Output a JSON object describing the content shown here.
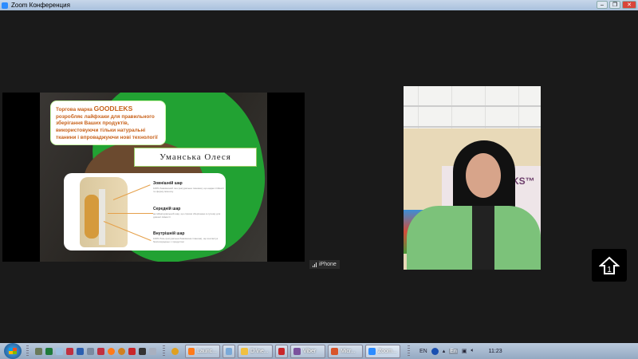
{
  "window": {
    "title": "Zoom Конференция"
  },
  "slide": {
    "callout": {
      "prefix": "Торгова марка ",
      "brand": "GOODLEKS",
      "text": " розробляє лайфхаки для правильного зберігання Ваших продуктів, використовуючи тільки натуральні тканини і впроваджуючи нові технології"
    },
    "name_label": "Уманська Олеся",
    "layers": [
      {
        "title": "Зовнішній шар",
        "desc": "100% бавовняний лен (натуральна тканина), що надає стійкості та форму мішечку"
      },
      {
        "title": "Середній шар",
        "desc": "антибактеріальний шар, що сприяє зберіганню в сухому для довшої свіжості"
      },
      {
        "title": "Внутрішній шар",
        "desc": "100% бязь (натуральна бавовняна тканина), що контактує безпосередньо з продуктом"
      }
    ]
  },
  "device_label": "iPhone",
  "share_button": {
    "icon": "share-screen-icon",
    "badge": "1"
  },
  "taskbar": {
    "tasks": [
      {
        "label": "Launc...",
        "color": "#ff7a1a"
      },
      {
        "label": "",
        "color": "#7aa9d8"
      },
      {
        "label": "D:\\ne...",
        "color": "#f0c040"
      },
      {
        "label": "",
        "color": "#c8262a"
      },
      {
        "label": "Viber",
        "color": "#7b519d"
      },
      {
        "label": "Micr...",
        "color": "#d8542a"
      },
      {
        "label": "Zoom...",
        "color": "#2d8cff"
      }
    ],
    "lang": "EN",
    "lang_indicator": "En",
    "clock": "11:23"
  }
}
